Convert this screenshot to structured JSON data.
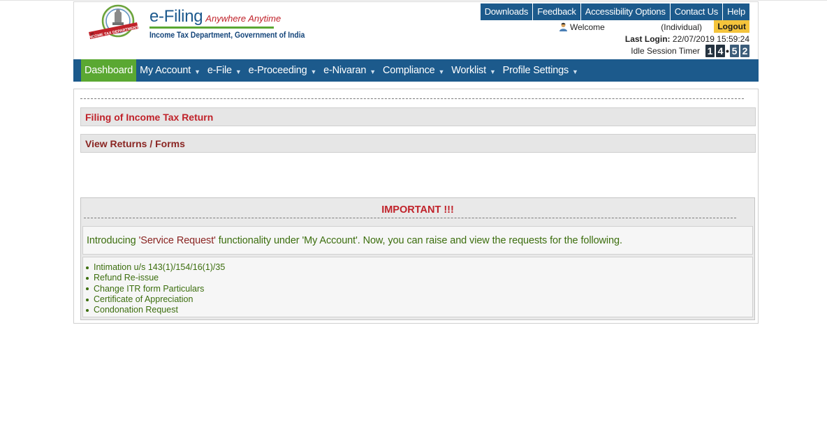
{
  "brand": {
    "title": "e-Filing",
    "tagline": "Anywhere Anytime",
    "department": "Income Tax Department, Government of India",
    "seal_text": "INCOME TAX DEPARTMENT"
  },
  "top_links": [
    "Downloads",
    "Feedback",
    "Accessibility Options",
    "Contact Us",
    "Help"
  ],
  "user": {
    "welcome": "Welcome",
    "type": "(Individual)",
    "logout": "Logout",
    "last_login_label": "Last Login:",
    "last_login_value": "22/07/2019 15:59:24",
    "idle_label": "Idle Session Timer",
    "timer_min": [
      "1",
      "4"
    ],
    "timer_sec": [
      "5",
      "2"
    ]
  },
  "nav": [
    {
      "label": "Dashboard",
      "active": true
    },
    {
      "label": "My Account",
      "caret": true
    },
    {
      "label": "e-File",
      "caret": true
    },
    {
      "label": "e-Proceeding",
      "caret": true
    },
    {
      "label": "e-Nivaran",
      "caret": true
    },
    {
      "label": "Compliance",
      "caret": true
    },
    {
      "label": "Worklist",
      "caret": true
    },
    {
      "label": "Profile Settings",
      "caret": true
    }
  ],
  "panels": {
    "filing": "Filing of Income Tax Return",
    "view_returns": "View Returns / Forms"
  },
  "important": {
    "title": "IMPORTANT !!!",
    "msg_prefix": "Introducing ",
    "msg_highlight": "'Service Request'",
    "msg_suffix": " functionality under 'My Account'. Now, you can raise and view the requests for the following.",
    "items": [
      "Intimation u/s 143(1)/154/16(1)/35",
      "Refund Re-issue",
      "Change ITR form Particulars",
      "Certificate of Appreciation",
      "Condonation Request"
    ]
  },
  "colors": {
    "nav_bg": "#1c5a8c",
    "active_tab": "#5aa832",
    "logout_bg": "#f4c43c",
    "title_red": "#c0222a",
    "text_green": "#3c6e0e"
  }
}
